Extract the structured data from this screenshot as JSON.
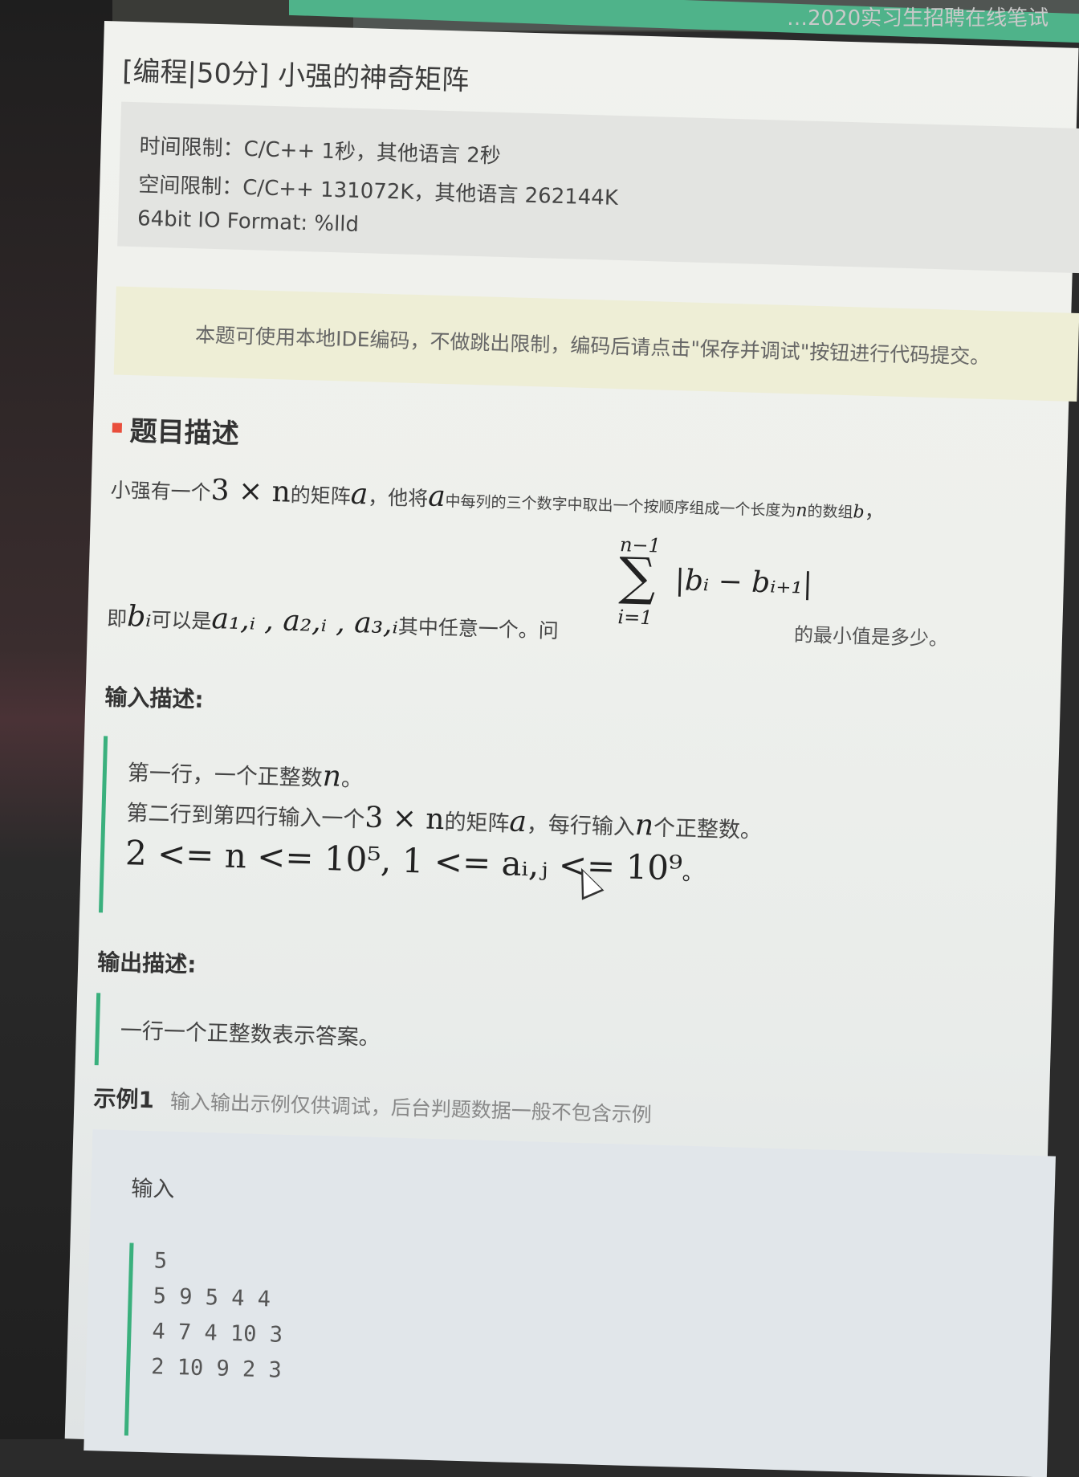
{
  "browser": {
    "tab_title": "…2020实习生招聘在线笔试"
  },
  "problem": {
    "title": "[编程|50分] 小强的神奇矩阵",
    "limits": [
      "时间限制：C/C++ 1秒，其他语言 2秒",
      "空间限制：C/C++ 131072K，其他语言 262144K",
      "64bit IO Format: %lld"
    ],
    "notice": "本题可使用本地IDE编码，不做跳出限制，编码后请点击\"保存并调试\"按钮进行代码提交。",
    "section_title": "题目描述",
    "desc_line1": {
      "t1": "小强有一个",
      "m1": "3 × n",
      "t2": "的矩阵",
      "m2": "a",
      "t3": "，他将",
      "m3": "a",
      "t4": "中每列的三个数字中取出一个按顺序组成一个长度为",
      "m4": "n",
      "t5": "的数组",
      "m5": "b",
      "t6": "，"
    },
    "desc_line2": {
      "t1": "即",
      "m1": "bᵢ",
      "t2": "可以是",
      "m2": "a₁,ᵢ , a₂,ᵢ , a₃,ᵢ",
      "t3": "其中任意一个。问",
      "t4": "的最小值是多少。"
    },
    "sum": {
      "top": "n−1",
      "sigma": "∑",
      "bottom": "i=1",
      "expr": "|bᵢ − bᵢ₊₁|"
    },
    "input_title": "输入描述:",
    "input_lines": {
      "l1_text": "第一行，一个正整数",
      "l1_math": "n",
      "l1_end": "。",
      "l2_t1": "第二行到第四行输入一个",
      "l2_m1": "3 × n",
      "l2_t2": "的矩阵",
      "l2_m2": "a",
      "l2_t3": "，每行输入",
      "l2_m3": "n",
      "l2_t4": "个正整数。",
      "l3_math": "2 <= n <= 10⁵, 1 <= aᵢ,ⱼ <= 10⁹",
      "l3_end": "。"
    },
    "output_title": "输出描述:",
    "output_text": "一行一个正整数表示答案。",
    "example_label": "示例1",
    "example_note": "输入输出示例仅供调试，后台判题数据一般不包含示例",
    "example_input_label": "输入",
    "example_input_lines": [
      "5",
      "5 9 5 4 4",
      "4 7 4 10 3",
      "2 10 9 2 3"
    ]
  }
}
